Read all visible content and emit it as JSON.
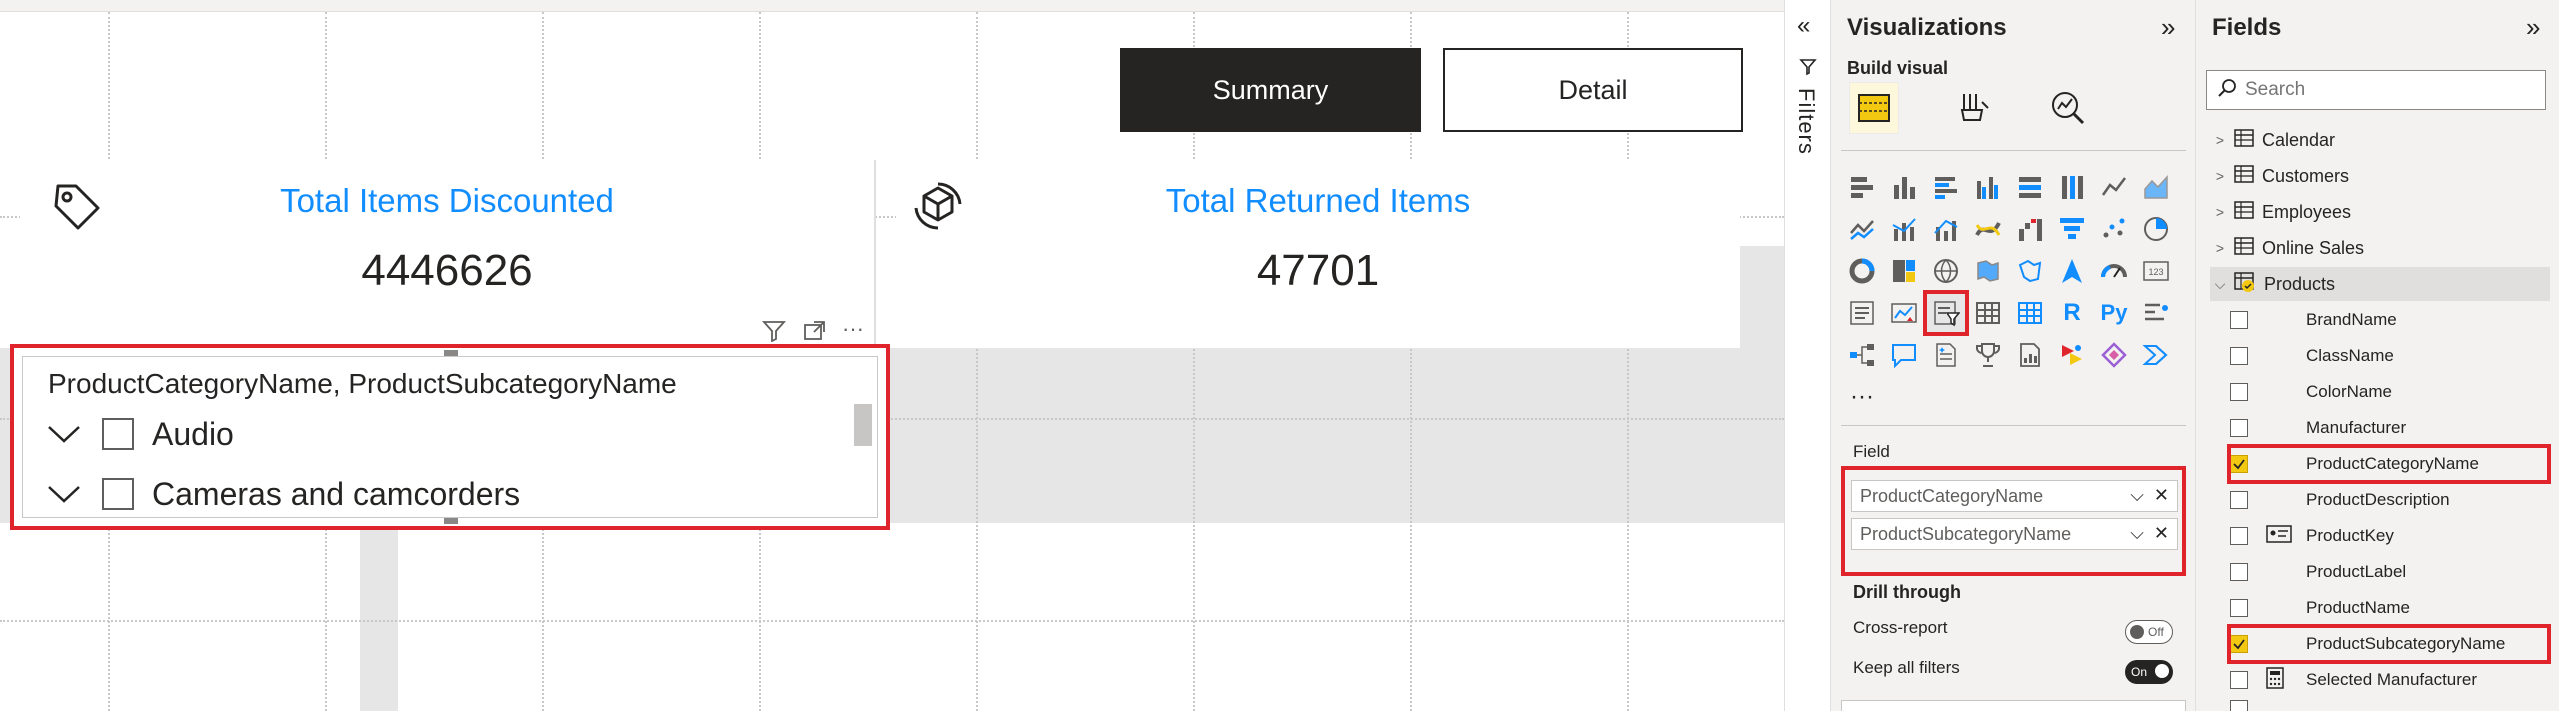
{
  "canvas": {
    "nav": {
      "summary": "Summary",
      "detail": "Detail"
    },
    "cards": [
      {
        "title": "Total Items Discounted",
        "value": "4446626",
        "icon": "price-tag-icon"
      },
      {
        "title": "Total Returned Items",
        "value": "47701",
        "icon": "return-box-icon"
      }
    ],
    "slicer": {
      "header": "ProductCategoryName, ProductSubcategoryName",
      "items": [
        "Audio",
        "Cameras and camcorders"
      ]
    }
  },
  "filters_rail": {
    "label": "Filters"
  },
  "visualizations": {
    "title": "Visualizations",
    "build_label": "Build visual",
    "more": "···",
    "field_label": "Field",
    "wells": [
      "ProductCategoryName",
      "ProductSubcategoryName"
    ],
    "drill_title": "Drill through",
    "cross_report": {
      "label": "Cross-report",
      "state": "Off"
    },
    "keep_filters": {
      "label": "Keep all filters",
      "state": "On"
    },
    "selected_visual": "slicer-icon"
  },
  "fields": {
    "title": "Fields",
    "search_placeholder": "Search",
    "tables": [
      "Calendar",
      "Customers",
      "Employees",
      "Online Sales",
      "Products"
    ],
    "product_fields": [
      {
        "name": "BrandName",
        "checked": false
      },
      {
        "name": "ClassName",
        "checked": false
      },
      {
        "name": "ColorName",
        "checked": false
      },
      {
        "name": "Manufacturer",
        "checked": false
      },
      {
        "name": "ProductCategoryName",
        "checked": true
      },
      {
        "name": "ProductDescription",
        "checked": false
      },
      {
        "name": "ProductKey",
        "checked": false
      },
      {
        "name": "ProductLabel",
        "checked": false
      },
      {
        "name": "ProductName",
        "checked": false
      },
      {
        "name": "ProductSubcategoryName",
        "checked": true
      },
      {
        "name": "Selected Manufacturer",
        "checked": false
      }
    ]
  },
  "colors": {
    "accent": "#118dff",
    "highlight": "#e0242c",
    "check": "#f2c811",
    "dark": "#252423"
  }
}
